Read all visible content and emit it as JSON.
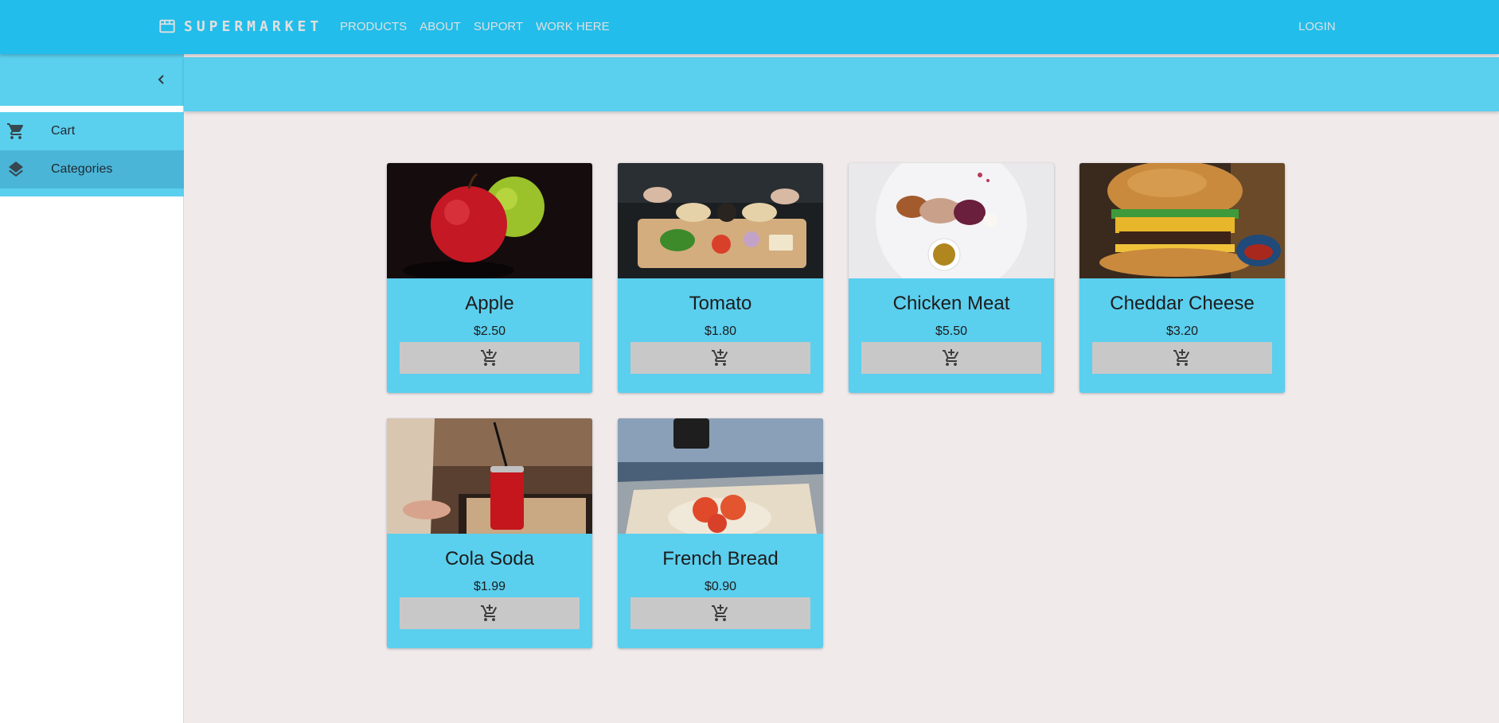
{
  "brand": {
    "name": "SUPERMARKET",
    "icon": "store-icon"
  },
  "nav": {
    "links": [
      "PRODUCTS",
      "ABOUT",
      "SUPORT",
      "WORK HERE"
    ],
    "login": "LOGIN"
  },
  "sidebar": {
    "collapse_icon": "chevron-left-icon",
    "items": [
      {
        "label": "Cart",
        "icon": "cart-icon"
      },
      {
        "label": "Categories",
        "icon": "layers-icon"
      }
    ]
  },
  "products": [
    {
      "name": "Apple",
      "price": "$2.50",
      "image": "apples-photo"
    },
    {
      "name": "Tomato",
      "price": "$1.80",
      "image": "cutting-board-photo"
    },
    {
      "name": "Chicken Meat",
      "price": "$5.50",
      "image": "plated-dish-photo"
    },
    {
      "name": "Cheddar Cheese",
      "price": "$3.20",
      "image": "burger-photo"
    },
    {
      "name": "Cola Soda",
      "price": "$1.99",
      "image": "cola-can-photo"
    },
    {
      "name": "French Bread",
      "price": "$0.90",
      "image": "bread-tray-photo"
    }
  ],
  "colors": {
    "appbar": "#22bdea",
    "accent": "#5bcfee",
    "selected": "#4bb5d8",
    "background": "#f0eaeb",
    "button": "#c8c8c8"
  }
}
